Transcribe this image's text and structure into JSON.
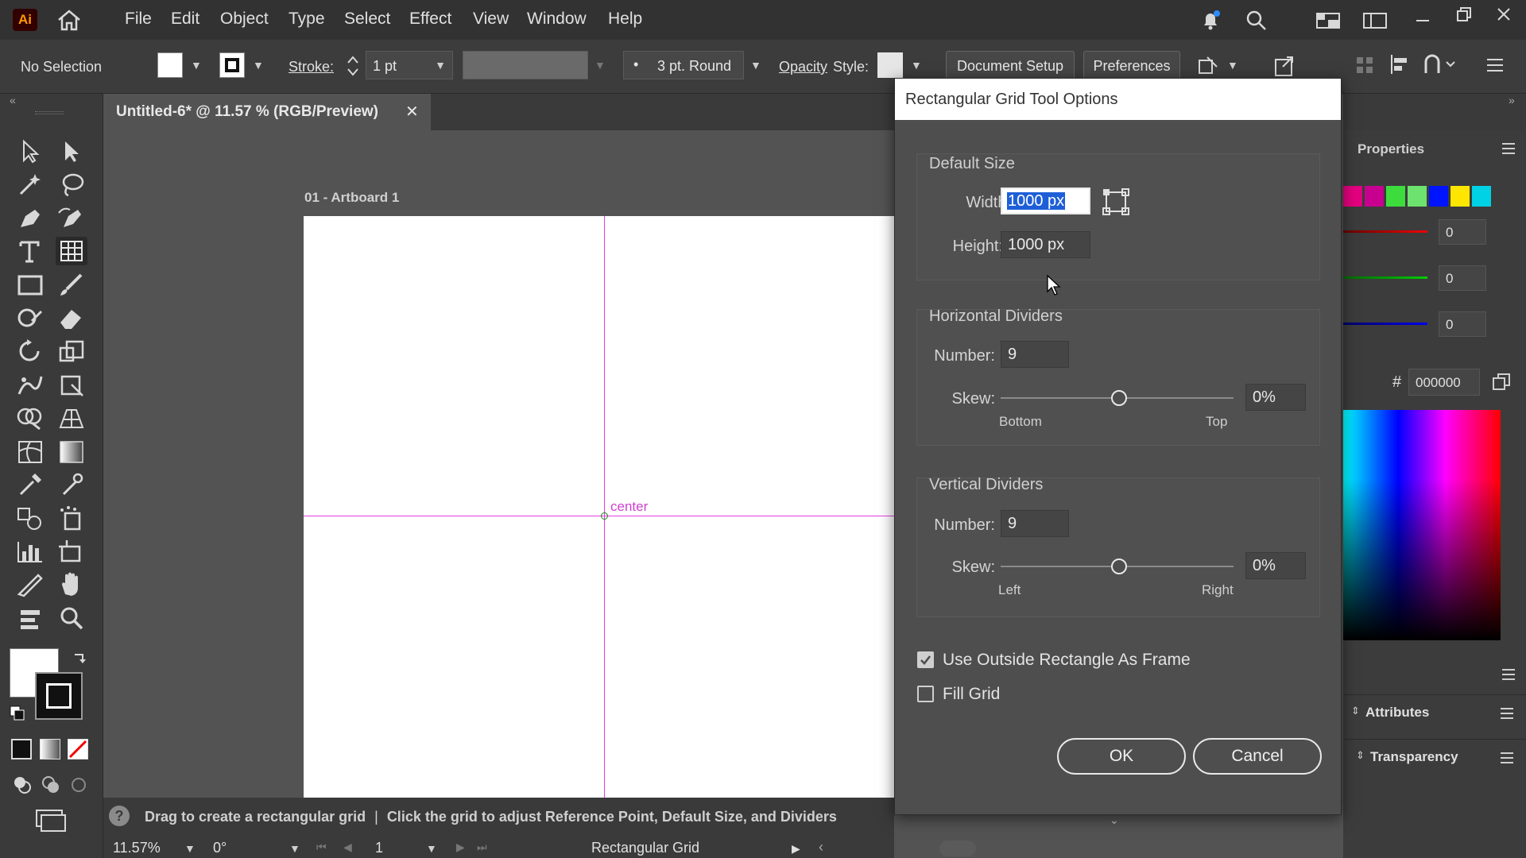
{
  "app": {
    "logo": "Ai"
  },
  "menu": [
    "File",
    "Edit",
    "Object",
    "Type",
    "Select",
    "Effect",
    "View",
    "Window",
    "Help"
  ],
  "control_bar": {
    "selection": "No Selection",
    "stroke_label": "Stroke:",
    "stroke_value": "1 pt",
    "brush": "3 pt. Round",
    "opacity_label": "Opacity",
    "style_label": "Style:",
    "document_setup": "Document Setup",
    "preferences": "Preferences"
  },
  "document": {
    "tab_title": "Untitled-6* @ 11.57 % (RGB/Preview)",
    "artboard_label": "01 - Artboard 1",
    "center_label": "center"
  },
  "status": {
    "help_text_1": "Drag to create a rectangular grid",
    "separator": "|",
    "help_text_2": "Click the grid to adjust Reference Point, Default Size, and Dividers",
    "zoom": "11.57%",
    "rotation": "0°",
    "artboard_number": "1",
    "tool_name": "Rectangular Grid"
  },
  "right_panel": {
    "tab": "Properties",
    "r": "0",
    "g": "0",
    "b": "0",
    "hash": "#",
    "hex": "000000",
    "attributes": "Attributes",
    "transparency": "Transparency",
    "swatches": [
      "#e4007f",
      "#c8008f",
      "#3ddc3d",
      "#6ee26e",
      "#0014ff",
      "#ffe600",
      "#00d2e6"
    ]
  },
  "dialog": {
    "title": "Rectangular Grid Tool Options",
    "default_size": {
      "title": "Default Size",
      "width_label": "Width:",
      "width_value": "1000 px",
      "height_label": "Height:",
      "height_value": "1000 px"
    },
    "horizontal": {
      "title": "Horizontal Dividers",
      "number_label": "Number:",
      "number_value": "9",
      "skew_label": "Skew:",
      "skew_value": "0%",
      "skew_position": 0.5,
      "left_hint": "Bottom",
      "right_hint": "Top"
    },
    "vertical": {
      "title": "Vertical Dividers",
      "number_label": "Number:",
      "number_value": "9",
      "skew_label": "Skew:",
      "skew_value": "0%",
      "skew_position": 0.5,
      "left_hint": "Left",
      "right_hint": "Right"
    },
    "use_outside_rect": {
      "label": "Use Outside Rectangle As Frame",
      "checked": true
    },
    "fill_grid": {
      "label": "Fill Grid",
      "checked": false
    },
    "ok": "OK",
    "cancel": "Cancel"
  }
}
